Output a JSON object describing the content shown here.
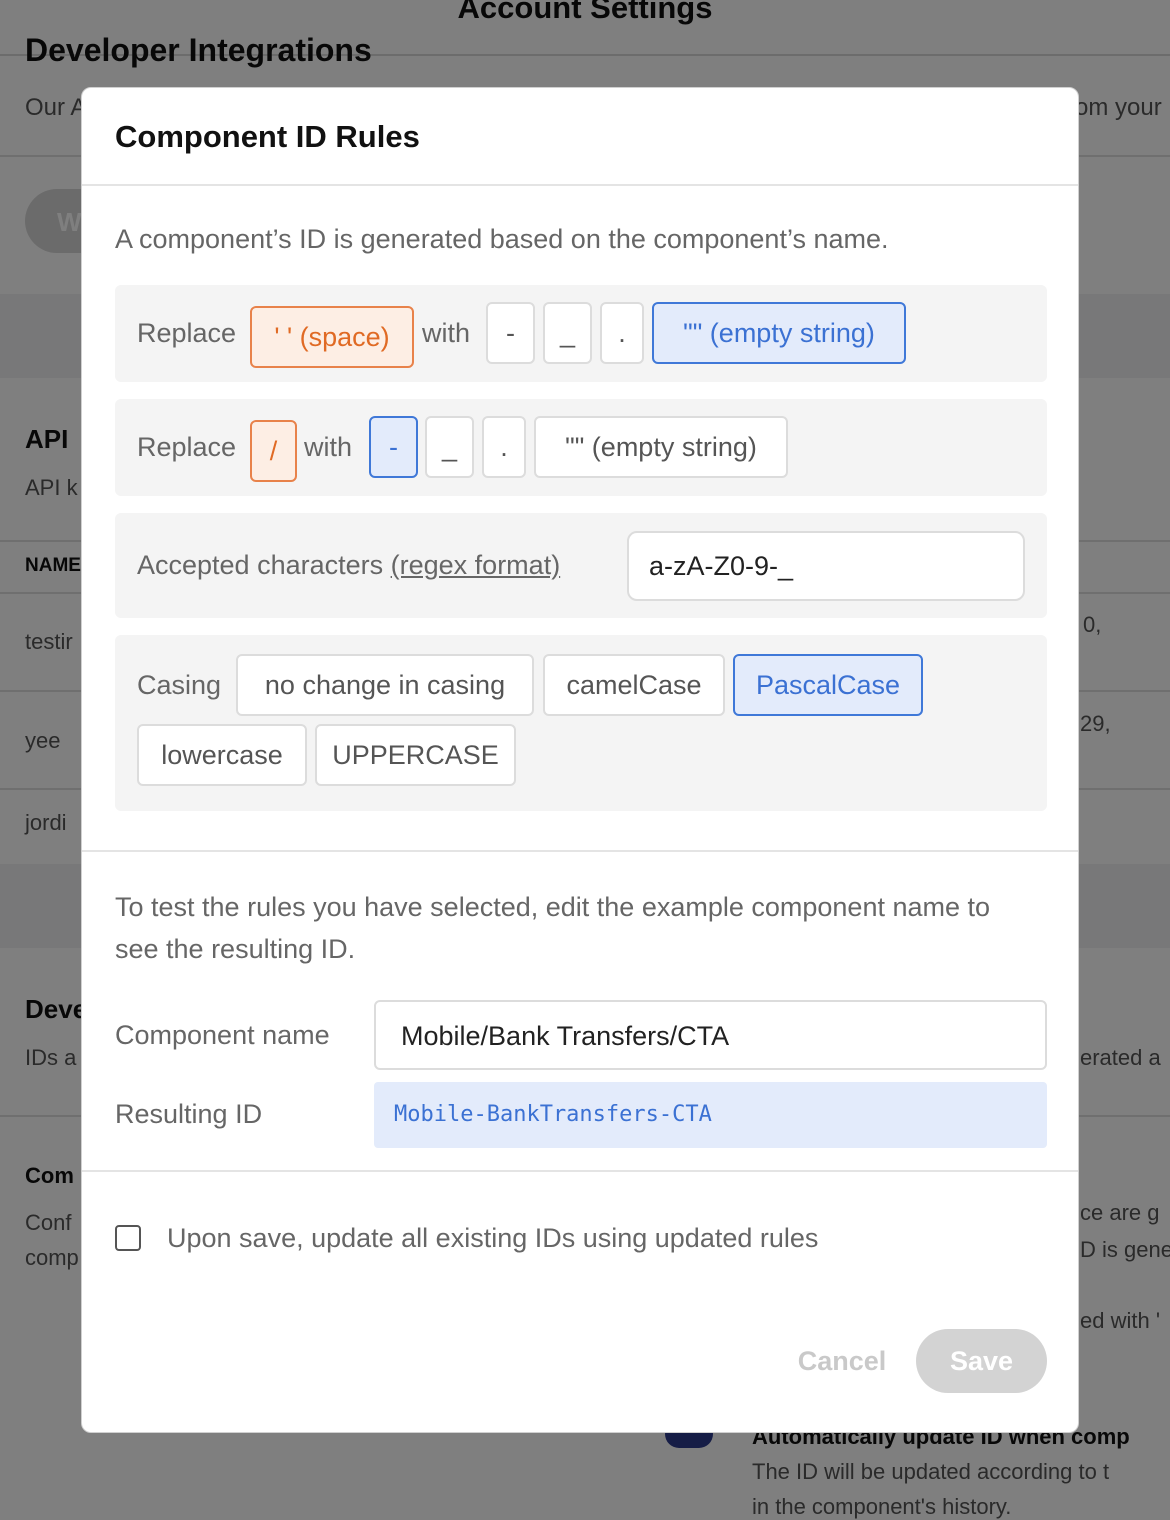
{
  "background": {
    "page_title": "Account Settings",
    "dev_integrations_heading": "Developer Integrations",
    "dev_integrations_text_left": "Our A",
    "dev_integrations_text_right": "om your",
    "pill_fragment": "W",
    "api_heading": "API",
    "api_text": "API k",
    "table_header": "NAME",
    "rows": [
      {
        "name": "testir",
        "right": "0,"
      },
      {
        "name": "yee",
        "right": "29,"
      },
      {
        "name": "jordi",
        "right": ""
      }
    ],
    "dev_heading": "Deve",
    "dev_text_left": "IDs a",
    "dev_text_right": "erated a",
    "comp_heading": "Com",
    "comp_text1_left": "Conf",
    "comp_text1_right": "ce are g",
    "comp_text2_left": "comp",
    "comp_text2_right": "D is gene",
    "comp_text3_right": "ed with '",
    "auto_update_heading": "Automatically update ID when comp",
    "auto_update_text1": "The ID will be updated according to t",
    "auto_update_text2": "in the component's history."
  },
  "modal": {
    "title": "Component ID Rules",
    "intro": "A component’s ID is generated based on the component’s name.",
    "rule_space": {
      "replace_label": "Replace",
      "target": "' ' (space)",
      "with_label": "with",
      "options": [
        "-",
        "_",
        ".",
        "\"\" (empty string)"
      ],
      "selected_index": 3
    },
    "rule_slash": {
      "replace_label": "Replace",
      "target": "/",
      "with_label": "with",
      "options": [
        "-",
        "_",
        ".",
        "\"\" (empty string)"
      ],
      "selected_index": 0
    },
    "accepted": {
      "label": "Accepted characters",
      "link": "(regex format)",
      "value": "a-zA-Z0-9-_"
    },
    "casing": {
      "label": "Casing",
      "options": [
        "no change in casing",
        "camelCase",
        "PascalCase",
        "lowercase",
        "UPPERCASE"
      ],
      "selected": "PascalCase"
    },
    "test": {
      "instructions": "To test the rules you have selected, edit the example component name to see the resulting ID.",
      "name_label": "Component name",
      "name_value": "Mobile/Bank Transfers/CTA",
      "result_label": "Resulting ID",
      "result_value": "Mobile-BankTransfers-CTA"
    },
    "update_checkbox": {
      "label": "Upon save, update all existing IDs using updated rules",
      "checked": false
    },
    "cancel_label": "Cancel",
    "save_label": "Save"
  },
  "colors": {
    "accent_blue": "#3b71d3",
    "selected_bg": "#e3ebfb",
    "target_orange": "#e06a24",
    "overlay": "rgba(0,0,0,0.5)"
  }
}
